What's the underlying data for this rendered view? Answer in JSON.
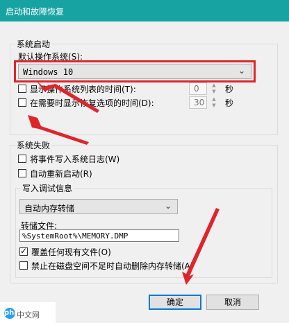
{
  "window": {
    "title": "启动和故障恢复"
  },
  "system_startup": {
    "group_title": "系统启动",
    "default_os_label": "默认操作系统(S):",
    "default_os_value": "Windows 10",
    "show_os_list": {
      "label": "显示操作系统列表的时间(T):",
      "checked": false,
      "value": "0",
      "unit": "秒"
    },
    "show_recovery": {
      "label": "在需要时显示恢复选项的时间(D):",
      "checked": false,
      "value": "30",
      "unit": "秒"
    }
  },
  "system_failure": {
    "group_title": "系统失败",
    "write_event_log": {
      "label": "将事件写入系统日志(W)",
      "checked": false
    },
    "auto_restart": {
      "label": "自动重新启动(R)",
      "checked": false
    }
  },
  "debug_info": {
    "group_title": "写入调试信息",
    "dump_type": "自动内存转储",
    "dump_file_label": "转储文件:",
    "dump_file_value": "%SystemRoot%\\MEMORY.DMP",
    "overwrite": {
      "label": "覆盖任何现有文件(O)",
      "checked": true
    },
    "disable_auto_delete": {
      "label": "禁止在磁盘空间不足时自动删除内存转储(A)",
      "checked": false
    }
  },
  "buttons": {
    "ok": "确定",
    "cancel": "取消"
  },
  "watermark": {
    "logo_text": "php",
    "text": "中文网"
  },
  "colors": {
    "annotation": "#e0242a",
    "titlebar": "#18a3a3",
    "primary_button_border": "#0078d7"
  }
}
